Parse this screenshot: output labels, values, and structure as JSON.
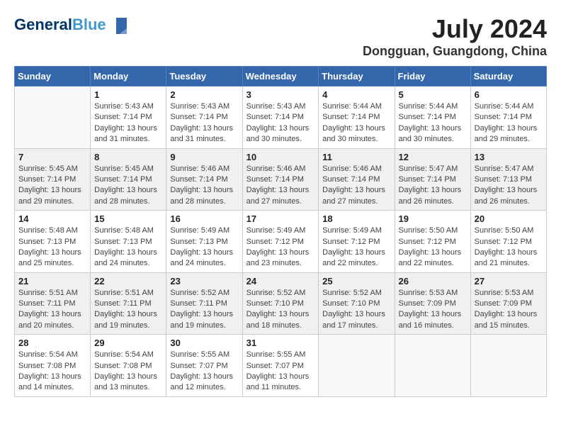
{
  "logo": {
    "general": "General",
    "blue": "Blue"
  },
  "title": "July 2024",
  "location": "Dongguan, Guangdong, China",
  "days_of_week": [
    "Sunday",
    "Monday",
    "Tuesday",
    "Wednesday",
    "Thursday",
    "Friday",
    "Saturday"
  ],
  "weeks": [
    [
      {
        "day": "",
        "sunrise": "",
        "sunset": "",
        "daylight": ""
      },
      {
        "day": "1",
        "sunrise": "Sunrise: 5:43 AM",
        "sunset": "Sunset: 7:14 PM",
        "daylight": "Daylight: 13 hours and 31 minutes."
      },
      {
        "day": "2",
        "sunrise": "Sunrise: 5:43 AM",
        "sunset": "Sunset: 7:14 PM",
        "daylight": "Daylight: 13 hours and 31 minutes."
      },
      {
        "day": "3",
        "sunrise": "Sunrise: 5:43 AM",
        "sunset": "Sunset: 7:14 PM",
        "daylight": "Daylight: 13 hours and 30 minutes."
      },
      {
        "day": "4",
        "sunrise": "Sunrise: 5:44 AM",
        "sunset": "Sunset: 7:14 PM",
        "daylight": "Daylight: 13 hours and 30 minutes."
      },
      {
        "day": "5",
        "sunrise": "Sunrise: 5:44 AM",
        "sunset": "Sunset: 7:14 PM",
        "daylight": "Daylight: 13 hours and 30 minutes."
      },
      {
        "day": "6",
        "sunrise": "Sunrise: 5:44 AM",
        "sunset": "Sunset: 7:14 PM",
        "daylight": "Daylight: 13 hours and 29 minutes."
      }
    ],
    [
      {
        "day": "7",
        "sunrise": "Sunrise: 5:45 AM",
        "sunset": "Sunset: 7:14 PM",
        "daylight": "Daylight: 13 hours and 29 minutes."
      },
      {
        "day": "8",
        "sunrise": "Sunrise: 5:45 AM",
        "sunset": "Sunset: 7:14 PM",
        "daylight": "Daylight: 13 hours and 28 minutes."
      },
      {
        "day": "9",
        "sunrise": "Sunrise: 5:46 AM",
        "sunset": "Sunset: 7:14 PM",
        "daylight": "Daylight: 13 hours and 28 minutes."
      },
      {
        "day": "10",
        "sunrise": "Sunrise: 5:46 AM",
        "sunset": "Sunset: 7:14 PM",
        "daylight": "Daylight: 13 hours and 27 minutes."
      },
      {
        "day": "11",
        "sunrise": "Sunrise: 5:46 AM",
        "sunset": "Sunset: 7:14 PM",
        "daylight": "Daylight: 13 hours and 27 minutes."
      },
      {
        "day": "12",
        "sunrise": "Sunrise: 5:47 AM",
        "sunset": "Sunset: 7:14 PM",
        "daylight": "Daylight: 13 hours and 26 minutes."
      },
      {
        "day": "13",
        "sunrise": "Sunrise: 5:47 AM",
        "sunset": "Sunset: 7:13 PM",
        "daylight": "Daylight: 13 hours and 26 minutes."
      }
    ],
    [
      {
        "day": "14",
        "sunrise": "Sunrise: 5:48 AM",
        "sunset": "Sunset: 7:13 PM",
        "daylight": "Daylight: 13 hours and 25 minutes."
      },
      {
        "day": "15",
        "sunrise": "Sunrise: 5:48 AM",
        "sunset": "Sunset: 7:13 PM",
        "daylight": "Daylight: 13 hours and 24 minutes."
      },
      {
        "day": "16",
        "sunrise": "Sunrise: 5:49 AM",
        "sunset": "Sunset: 7:13 PM",
        "daylight": "Daylight: 13 hours and 24 minutes."
      },
      {
        "day": "17",
        "sunrise": "Sunrise: 5:49 AM",
        "sunset": "Sunset: 7:12 PM",
        "daylight": "Daylight: 13 hours and 23 minutes."
      },
      {
        "day": "18",
        "sunrise": "Sunrise: 5:49 AM",
        "sunset": "Sunset: 7:12 PM",
        "daylight": "Daylight: 13 hours and 22 minutes."
      },
      {
        "day": "19",
        "sunrise": "Sunrise: 5:50 AM",
        "sunset": "Sunset: 7:12 PM",
        "daylight": "Daylight: 13 hours and 22 minutes."
      },
      {
        "day": "20",
        "sunrise": "Sunrise: 5:50 AM",
        "sunset": "Sunset: 7:12 PM",
        "daylight": "Daylight: 13 hours and 21 minutes."
      }
    ],
    [
      {
        "day": "21",
        "sunrise": "Sunrise: 5:51 AM",
        "sunset": "Sunset: 7:11 PM",
        "daylight": "Daylight: 13 hours and 20 minutes."
      },
      {
        "day": "22",
        "sunrise": "Sunrise: 5:51 AM",
        "sunset": "Sunset: 7:11 PM",
        "daylight": "Daylight: 13 hours and 19 minutes."
      },
      {
        "day": "23",
        "sunrise": "Sunrise: 5:52 AM",
        "sunset": "Sunset: 7:11 PM",
        "daylight": "Daylight: 13 hours and 19 minutes."
      },
      {
        "day": "24",
        "sunrise": "Sunrise: 5:52 AM",
        "sunset": "Sunset: 7:10 PM",
        "daylight": "Daylight: 13 hours and 18 minutes."
      },
      {
        "day": "25",
        "sunrise": "Sunrise: 5:52 AM",
        "sunset": "Sunset: 7:10 PM",
        "daylight": "Daylight: 13 hours and 17 minutes."
      },
      {
        "day": "26",
        "sunrise": "Sunrise: 5:53 AM",
        "sunset": "Sunset: 7:09 PM",
        "daylight": "Daylight: 13 hours and 16 minutes."
      },
      {
        "day": "27",
        "sunrise": "Sunrise: 5:53 AM",
        "sunset": "Sunset: 7:09 PM",
        "daylight": "Daylight: 13 hours and 15 minutes."
      }
    ],
    [
      {
        "day": "28",
        "sunrise": "Sunrise: 5:54 AM",
        "sunset": "Sunset: 7:08 PM",
        "daylight": "Daylight: 13 hours and 14 minutes."
      },
      {
        "day": "29",
        "sunrise": "Sunrise: 5:54 AM",
        "sunset": "Sunset: 7:08 PM",
        "daylight": "Daylight: 13 hours and 13 minutes."
      },
      {
        "day": "30",
        "sunrise": "Sunrise: 5:55 AM",
        "sunset": "Sunset: 7:07 PM",
        "daylight": "Daylight: 13 hours and 12 minutes."
      },
      {
        "day": "31",
        "sunrise": "Sunrise: 5:55 AM",
        "sunset": "Sunset: 7:07 PM",
        "daylight": "Daylight: 13 hours and 11 minutes."
      },
      {
        "day": "",
        "sunrise": "",
        "sunset": "",
        "daylight": ""
      },
      {
        "day": "",
        "sunrise": "",
        "sunset": "",
        "daylight": ""
      },
      {
        "day": "",
        "sunrise": "",
        "sunset": "",
        "daylight": ""
      }
    ]
  ]
}
